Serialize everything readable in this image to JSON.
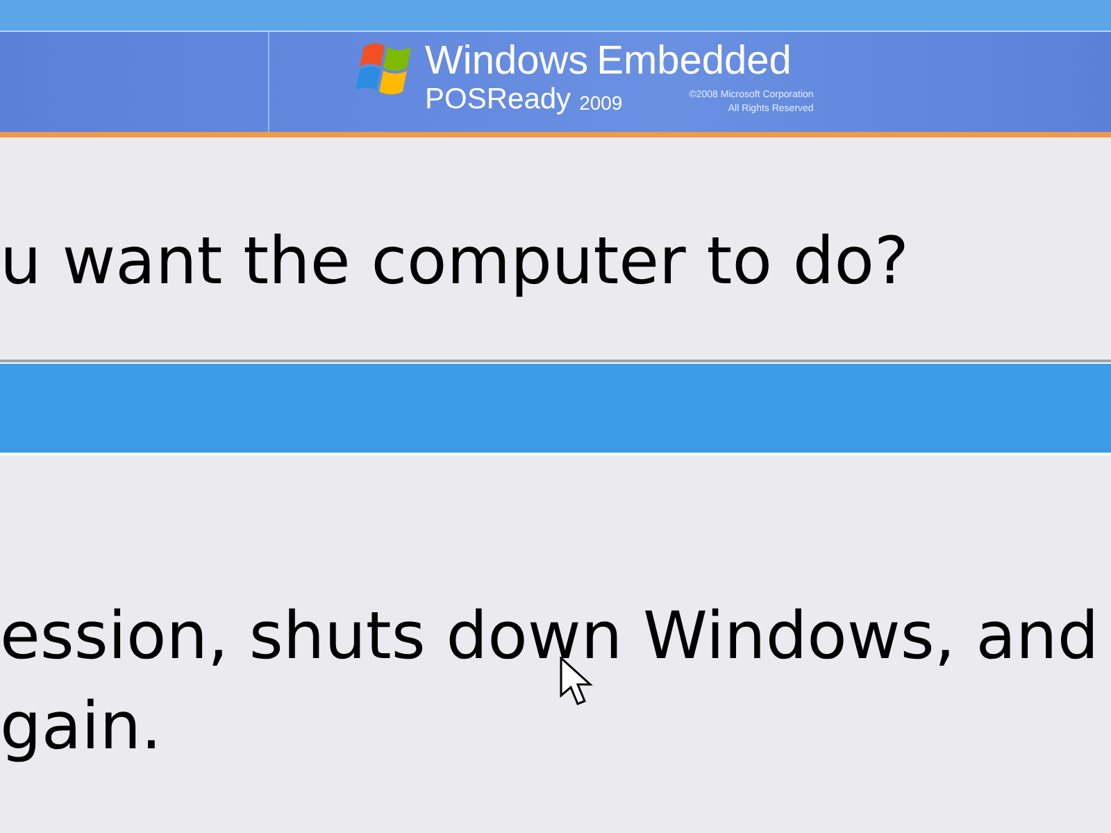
{
  "banner": {
    "product": "Windows",
    "edition": "Embedded",
    "subtitle": "POSReady",
    "version": "2009",
    "copyright": "©2008 Microsoft Corporation",
    "rights": "All Rights Reserved"
  },
  "question": "u want the computer to do?",
  "action_select": {
    "selected": true
  },
  "description_lines": [
    "ession, shuts down Windows, and",
    "gain."
  ]
}
